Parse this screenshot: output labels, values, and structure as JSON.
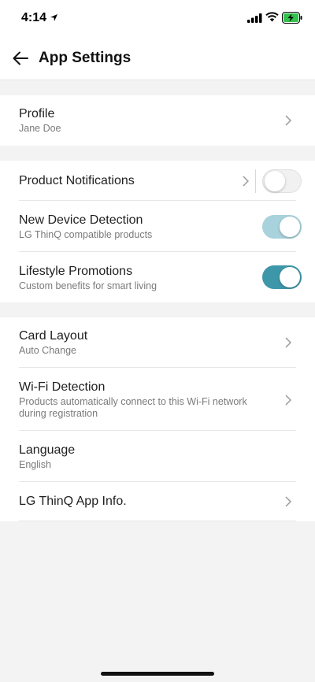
{
  "status_bar": {
    "time": "4:14",
    "icons": [
      "location-arrow-icon",
      "signal-icon",
      "wifi-icon",
      "battery-charging-icon"
    ],
    "battery_color": "#33c24d"
  },
  "header": {
    "title": "App Settings",
    "back_icon": "arrow-left-icon"
  },
  "profile": {
    "title": "Profile",
    "subtitle": "Jane Doe"
  },
  "notifications": {
    "product_notifications": {
      "title": "Product Notifications",
      "enabled": false
    },
    "new_device_detection": {
      "title": "New Device Detection",
      "subtitle": "LG ThinQ compatible products",
      "enabled": true
    },
    "lifestyle_promotions": {
      "title": "Lifestyle Promotions",
      "subtitle": "Custom benefits for smart living",
      "enabled": true
    }
  },
  "general": {
    "card_layout": {
      "title": "Card Layout",
      "subtitle": "Auto Change"
    },
    "wifi_detection": {
      "title": "Wi-Fi Detection",
      "subtitle_line1": "Products automatically connect to this Wi-Fi network",
      "subtitle_line2": "during registration"
    },
    "language": {
      "title": "Language",
      "subtitle": "English"
    },
    "app_info": {
      "title": "LG ThinQ App Info."
    }
  },
  "colors": {
    "accent": "#3d97a8",
    "accent_light": "#a8d2dc",
    "background": "#f3f3f3"
  }
}
